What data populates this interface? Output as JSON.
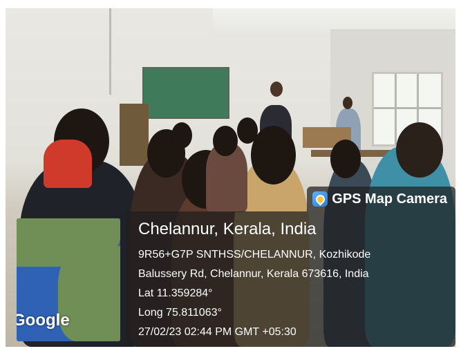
{
  "overlay": {
    "app_name": "GPS Map Camera",
    "app_icon": "gps-map-camera-icon",
    "location_title": "Chelannur, Kerala, India",
    "address_line1": "9R56+G7P SNTHSS/CHELANNUR, Kozhikode",
    "address_line2": "Balussery Rd, Chelannur, Kerala 673616, India",
    "latitude": "Lat 11.359284°",
    "longitude": "Long 75.811063°",
    "timestamp": "27/02/23 02:44 PM GMT +05:30",
    "map_logo": "Google"
  },
  "colors": {
    "overlay_background": "#1e1e1e",
    "overlay_text": "#ffffff",
    "map_water": "#2f62b5",
    "map_land": "#6f8f56",
    "chalkboard": "#3f7a5a"
  }
}
